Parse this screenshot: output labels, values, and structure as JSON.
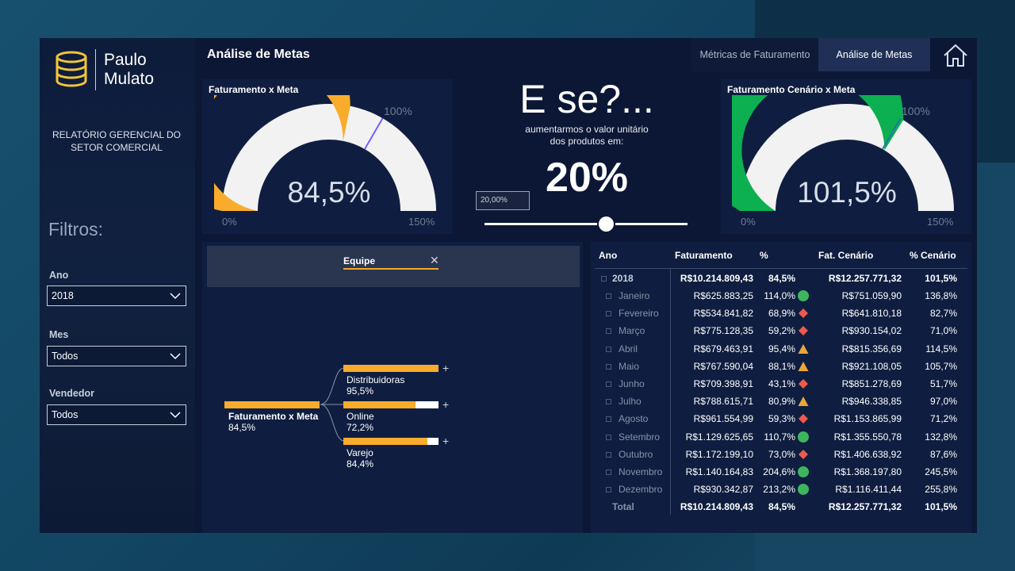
{
  "brand": {
    "name_line1": "Paulo",
    "name_line2": "Mulato"
  },
  "sidebar": {
    "report_title": "RELATÓRIO GERENCIAL DO SETOR COMERCIAL",
    "filters_title": "Filtros:",
    "filters": [
      {
        "label": "Ano",
        "value": "2018"
      },
      {
        "label": "Mes",
        "value": "Todos"
      },
      {
        "label": "Vendedor",
        "value": "Todos"
      }
    ]
  },
  "header": {
    "title": "Análise de Metas",
    "tabs": [
      {
        "label": "Métricas de Faturamento",
        "active": false
      },
      {
        "label": "Análise de Metas",
        "active": true
      }
    ]
  },
  "gauge_left": {
    "title": "Faturamento x Meta",
    "value_label": "84,5%",
    "value": 84.5,
    "min_label": "0%",
    "max_label": "150%",
    "target_label": "100%",
    "target": 100,
    "max": 150,
    "color": "#f9ac2b"
  },
  "whatif": {
    "title": "E se?...",
    "subtitle_line1": "aumentarmos o valor unitário",
    "subtitle_line2": "dos produtos em:",
    "percent": "20%",
    "input_value": "20,00%",
    "slider_fraction": 0.6
  },
  "gauge_right": {
    "title": "Faturamento Cenário x Meta",
    "value_label": "101,5%",
    "value": 101.5,
    "min_label": "0%",
    "max_label": "150%",
    "target_label": "100%",
    "target": 100,
    "max": 150,
    "color": "#0db050"
  },
  "decomp": {
    "field": "Equipe",
    "root": {
      "label": "Faturamento x Meta",
      "value": "84,5%"
    },
    "children": [
      {
        "label": "Distribuidoras",
        "value": "95,5%",
        "fraction": 1.0
      },
      {
        "label": "Online",
        "value": "72,2%",
        "fraction": 0.76
      },
      {
        "label": "Varejo",
        "value": "84,4%",
        "fraction": 0.88
      }
    ]
  },
  "table": {
    "headers": {
      "ano": "Ano",
      "fat": "Faturamento",
      "pct": "%",
      "cen": "Fat. Cenário",
      "pcen": "% Cenário"
    },
    "year": {
      "label": "2018",
      "fat": "R$10.214.809,43",
      "pct": "84,5%",
      "cen": "R$12.257.771,32",
      "pcen": "101,5%"
    },
    "rows": [
      {
        "month": "Janeiro",
        "fat": "R$625.883,25",
        "pct": "114,0%",
        "status": "green",
        "cen": "R$751.059,90",
        "pcen": "136,8%"
      },
      {
        "month": "Fevereiro",
        "fat": "R$534.841,82",
        "pct": "68,9%",
        "status": "red",
        "cen": "R$641.810,18",
        "pcen": "82,7%"
      },
      {
        "month": "Março",
        "fat": "R$775.128,35",
        "pct": "59,2%",
        "status": "red",
        "cen": "R$930.154,02",
        "pcen": "71,0%"
      },
      {
        "month": "Abril",
        "fat": "R$679.463,91",
        "pct": "95,4%",
        "status": "yellow",
        "cen": "R$815.356,69",
        "pcen": "114,5%"
      },
      {
        "month": "Maio",
        "fat": "R$767.590,04",
        "pct": "88,1%",
        "status": "yellow",
        "cen": "R$921.108,05",
        "pcen": "105,7%"
      },
      {
        "month": "Junho",
        "fat": "R$709.398,91",
        "pct": "43,1%",
        "status": "red",
        "cen": "R$851.278,69",
        "pcen": "51,7%"
      },
      {
        "month": "Julho",
        "fat": "R$788.615,71",
        "pct": "80,9%",
        "status": "yellow",
        "cen": "R$946.338,85",
        "pcen": "97,0%"
      },
      {
        "month": "Agosto",
        "fat": "R$961.554,99",
        "pct": "59,3%",
        "status": "red",
        "cen": "R$1.153.865,99",
        "pcen": "71,2%"
      },
      {
        "month": "Setembro",
        "fat": "R$1.129.625,65",
        "pct": "110,7%",
        "status": "green",
        "cen": "R$1.355.550,78",
        "pcen": "132,8%"
      },
      {
        "month": "Outubro",
        "fat": "R$1.172.199,10",
        "pct": "73,0%",
        "status": "red",
        "cen": "R$1.406.638,92",
        "pcen": "87,6%"
      },
      {
        "month": "Novembro",
        "fat": "R$1.140.164,83",
        "pct": "204,6%",
        "status": "green",
        "cen": "R$1.368.197,80",
        "pcen": "245,5%"
      },
      {
        "month": "Dezembro",
        "fat": "R$930.342,87",
        "pct": "213,2%",
        "status": "green",
        "cen": "R$1.116.411,44",
        "pcen": "255,8%"
      }
    ],
    "total": {
      "label": "Total",
      "fat": "R$10.214.809,43",
      "pct": "84,5%",
      "cen": "R$12.257.771,32",
      "pcen": "101,5%"
    }
  },
  "colors": {
    "green": "#3db55c",
    "red": "#f05a4a",
    "yellow": "#e8a838",
    "gauge_bg": "#f2f2f2",
    "target_left": "#7a5cff",
    "target_right": "#1e7aa8"
  }
}
